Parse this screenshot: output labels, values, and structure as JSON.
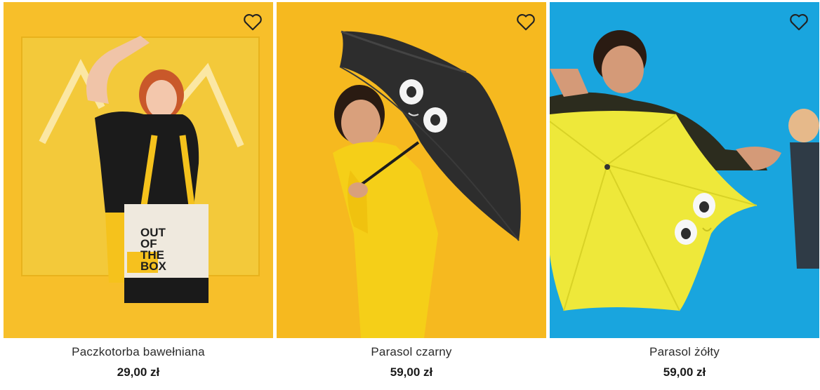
{
  "products": [
    {
      "name": "Paczkotorba bawełniana",
      "price": "29,00 zł",
      "image_alt": "tote bag product photo",
      "bag_print": [
        "OUT",
        "OF",
        "THE",
        "BOX"
      ],
      "background_color": "#f7bf2a"
    },
    {
      "name": "Parasol czarny",
      "price": "59,00 zł",
      "image_alt": "black umbrella product photo",
      "background_color": "#f6b91f"
    },
    {
      "name": "Parasol żółty",
      "price": "59,00 zł",
      "image_alt": "yellow umbrella product photo",
      "background_color": "#19a5de"
    }
  ],
  "icons": {
    "favorite": "heart-outline-icon"
  }
}
